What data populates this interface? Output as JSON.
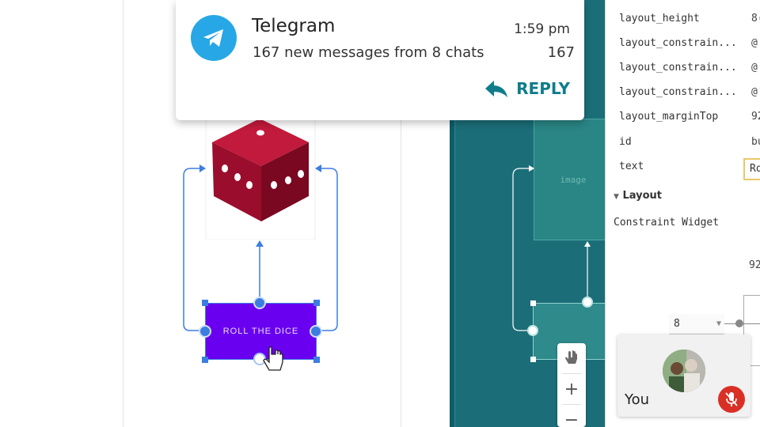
{
  "notification": {
    "app": "Telegram",
    "time": "1:59 pm",
    "message": "167 new messages from 8 chats",
    "count": "167",
    "reply_label": "REPLY"
  },
  "design": {
    "button_text": "ROLL THE DICE"
  },
  "blueprint": {
    "image_label": "image",
    "zoom_in": "+",
    "zoom_out": "−"
  },
  "attributes": {
    "rows": [
      {
        "name": "layout_height",
        "value": "8("
      },
      {
        "name": "layout_constrain...",
        "value": "@"
      },
      {
        "name": "layout_constrain...",
        "value": "@"
      },
      {
        "name": "layout_constrain...",
        "value": "@"
      },
      {
        "name": "layout_marginTop",
        "value": "92"
      },
      {
        "name": "id",
        "value": "bu"
      }
    ],
    "text_attr": {
      "name": "text",
      "value": "Ro"
    },
    "layout_section": "Layout",
    "constraint_widget": "Constraint Widget",
    "margin_top_value": "92",
    "margin_select_value": "8"
  },
  "video": {
    "you_label": "You",
    "mic_state": "muted"
  },
  "colors": {
    "telegram": "#27a7e5",
    "button_purple": "#6a00f0",
    "selection_blue": "#3d7de0",
    "blueprint_teal": "#1b6e78",
    "reply_teal": "#0f7d8a",
    "mute_red": "#d93025"
  }
}
